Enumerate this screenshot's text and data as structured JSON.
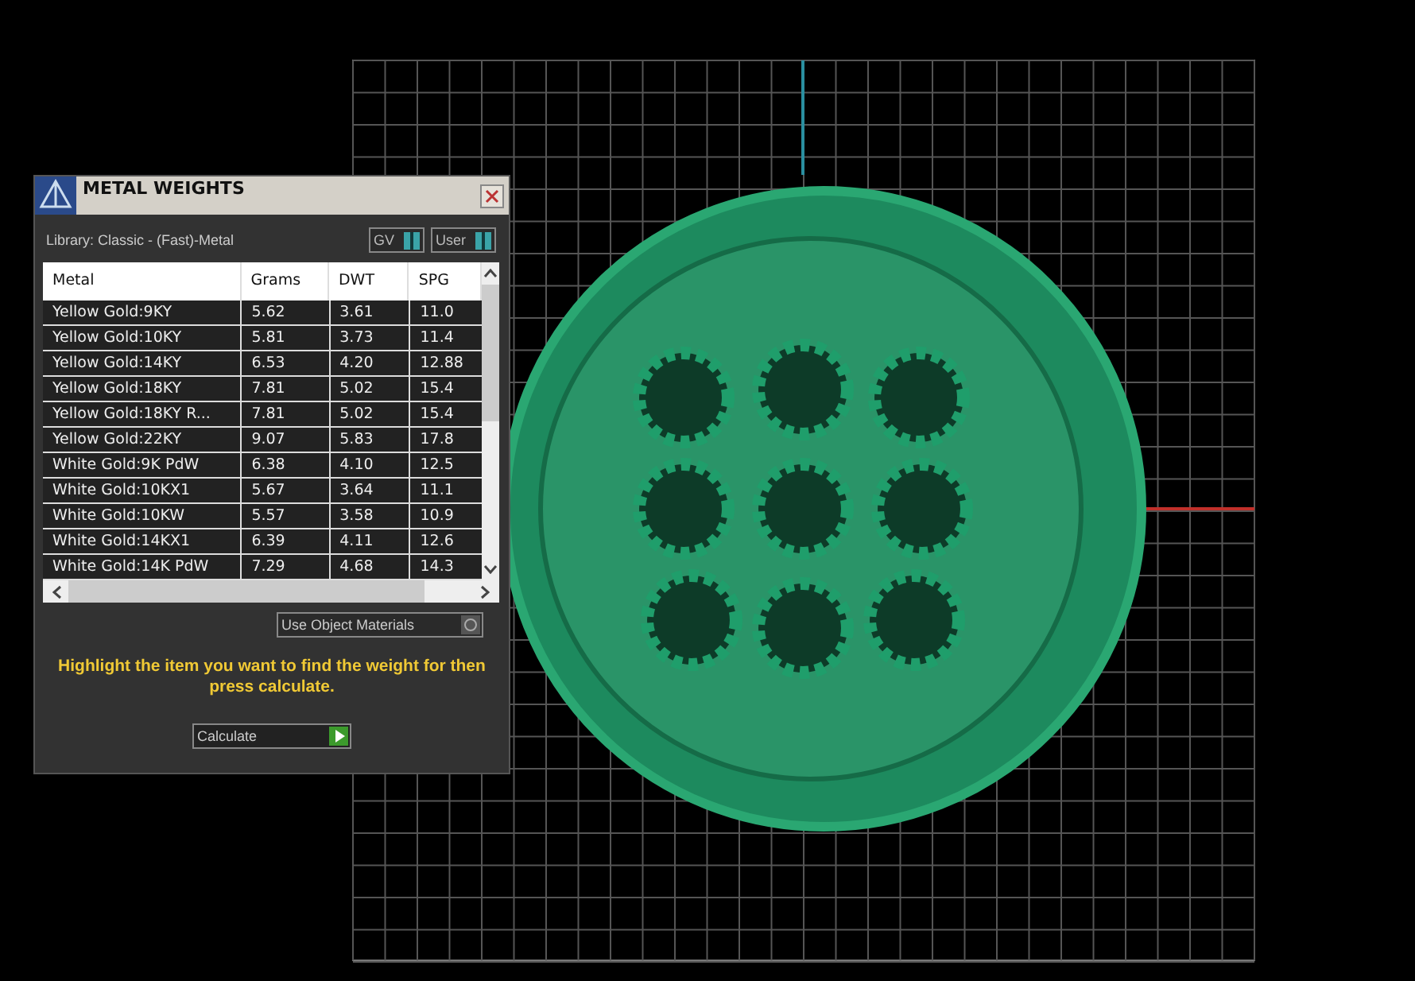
{
  "panel": {
    "title": "METAL WEIGHTS",
    "library": "Library: Classic - (Fast)-Metal",
    "toggles": [
      {
        "label": "GV",
        "on": true
      },
      {
        "label": "User",
        "on": true
      }
    ],
    "table": {
      "columns": [
        "Metal",
        "Grams",
        "DWT",
        "SPG"
      ],
      "rows": [
        [
          "Yellow Gold:9KY",
          "5.62",
          "3.61",
          "11.0"
        ],
        [
          "Yellow Gold:10KY",
          "5.81",
          "3.73",
          "11.4"
        ],
        [
          "Yellow Gold:14KY",
          "6.53",
          "4.20",
          "12.88"
        ],
        [
          "Yellow Gold:18KY",
          "7.81",
          "5.02",
          "15.4"
        ],
        [
          "Yellow Gold:18KY R...",
          "7.81",
          "5.02",
          "15.4"
        ],
        [
          "Yellow Gold:22KY",
          "9.07",
          "5.83",
          "17.8"
        ],
        [
          "White Gold:9K PdW",
          "6.38",
          "4.10",
          "12.5"
        ],
        [
          "White Gold:10KX1",
          "5.67",
          "3.64",
          "11.1"
        ],
        [
          "White Gold:10KW",
          "5.57",
          "3.58",
          "10.9"
        ],
        [
          "White Gold:14KX1",
          "6.39",
          "4.11",
          "12.6"
        ],
        [
          "White Gold:14K PdW",
          "7.29",
          "4.68",
          "14.3"
        ]
      ]
    },
    "use_object_materials": {
      "label": "Use Object Materials",
      "checked": false
    },
    "hint": "Highlight the item you want to find the weight for then press calculate.",
    "calculate_button": "Calculate"
  }
}
